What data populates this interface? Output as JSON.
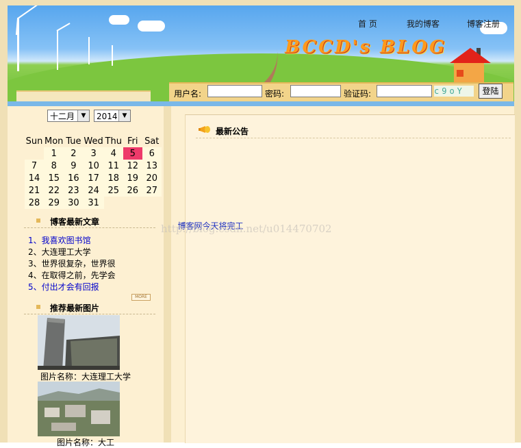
{
  "nav": {
    "items": [
      {
        "label": "首 页"
      },
      {
        "label": "我的博客"
      },
      {
        "label": "博客注册"
      }
    ]
  },
  "header": {
    "logo_text": "BCCD's BLOG"
  },
  "login": {
    "username_label": "用户名:",
    "password_label": "密码:",
    "captcha_label": "验证码:",
    "captcha_text": "c9oY",
    "button_label": "登陆",
    "username_value": "",
    "password_value": "",
    "captcha_value": ""
  },
  "calendar": {
    "month": "十二月",
    "year": "2014",
    "weekdays": [
      "Sun",
      "Mon",
      "Tue",
      "Wed",
      "Thu",
      "Fri",
      "Sat"
    ],
    "weeks": [
      [
        "",
        "1",
        "2",
        "3",
        "4",
        "5",
        "6"
      ],
      [
        "7",
        "8",
        "9",
        "10",
        "11",
        "12",
        "13"
      ],
      [
        "14",
        "15",
        "16",
        "17",
        "18",
        "19",
        "20"
      ],
      [
        "21",
        "22",
        "23",
        "24",
        "25",
        "26",
        "27"
      ],
      [
        "28",
        "29",
        "30",
        "31",
        "",
        "",
        ""
      ]
    ],
    "today": "5"
  },
  "latest_articles": {
    "title": "博客最新文章",
    "items": [
      {
        "text": "1、我喜欢图书馆"
      },
      {
        "text": "2、大连理工大学"
      },
      {
        "text": "3、世界很复杂，世界很"
      },
      {
        "text": "4、在取得之前，先学会"
      },
      {
        "text": "5、付出才会有回报"
      }
    ],
    "more_label": "MORE"
  },
  "recommended_pictures": {
    "title": "推荐最新图片",
    "items": [
      {
        "caption": "图片名称：大连理工大学"
      },
      {
        "caption": "图片名称：大工"
      }
    ]
  },
  "announcement": {
    "title": "最新公告",
    "text": "博客网今天将完工"
  },
  "watermark": "http://blog.csdn.net/u014470702",
  "colors": {
    "link": "#0000cc",
    "today": "#ee3a6a",
    "accent": "#e4b85a"
  }
}
